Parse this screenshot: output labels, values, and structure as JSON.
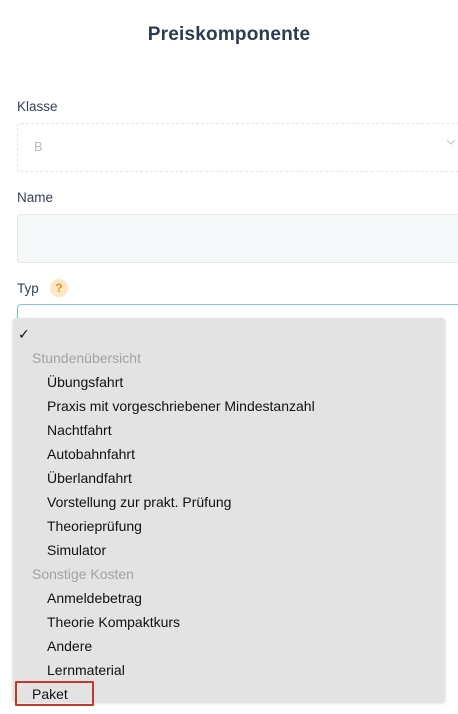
{
  "page": {
    "title": "Preiskomponente"
  },
  "klasse": {
    "label": "Klasse",
    "value": "B"
  },
  "name": {
    "label": "Name",
    "value": ""
  },
  "typ": {
    "label": "Typ",
    "help": "?"
  },
  "dropdown": {
    "checkmark": "✓",
    "groups": [
      {
        "label": "Stundenübersicht",
        "options": [
          "Übungsfahrt",
          "Praxis mit vorgeschriebener Mindestanzahl",
          "Nachtfahrt",
          "Autobahnfahrt",
          "Überlandfahrt",
          "Vorstellung zur prakt. Prüfung",
          "Theorieprüfung",
          "Simulator"
        ]
      },
      {
        "label": "Sonstige Kosten",
        "options": [
          "Anmeldebetrag",
          "Theorie Kompaktkurs",
          "Andere",
          "Lernmaterial"
        ]
      }
    ],
    "last_option": "Paket",
    "highlight_color": "#c23a2a"
  }
}
